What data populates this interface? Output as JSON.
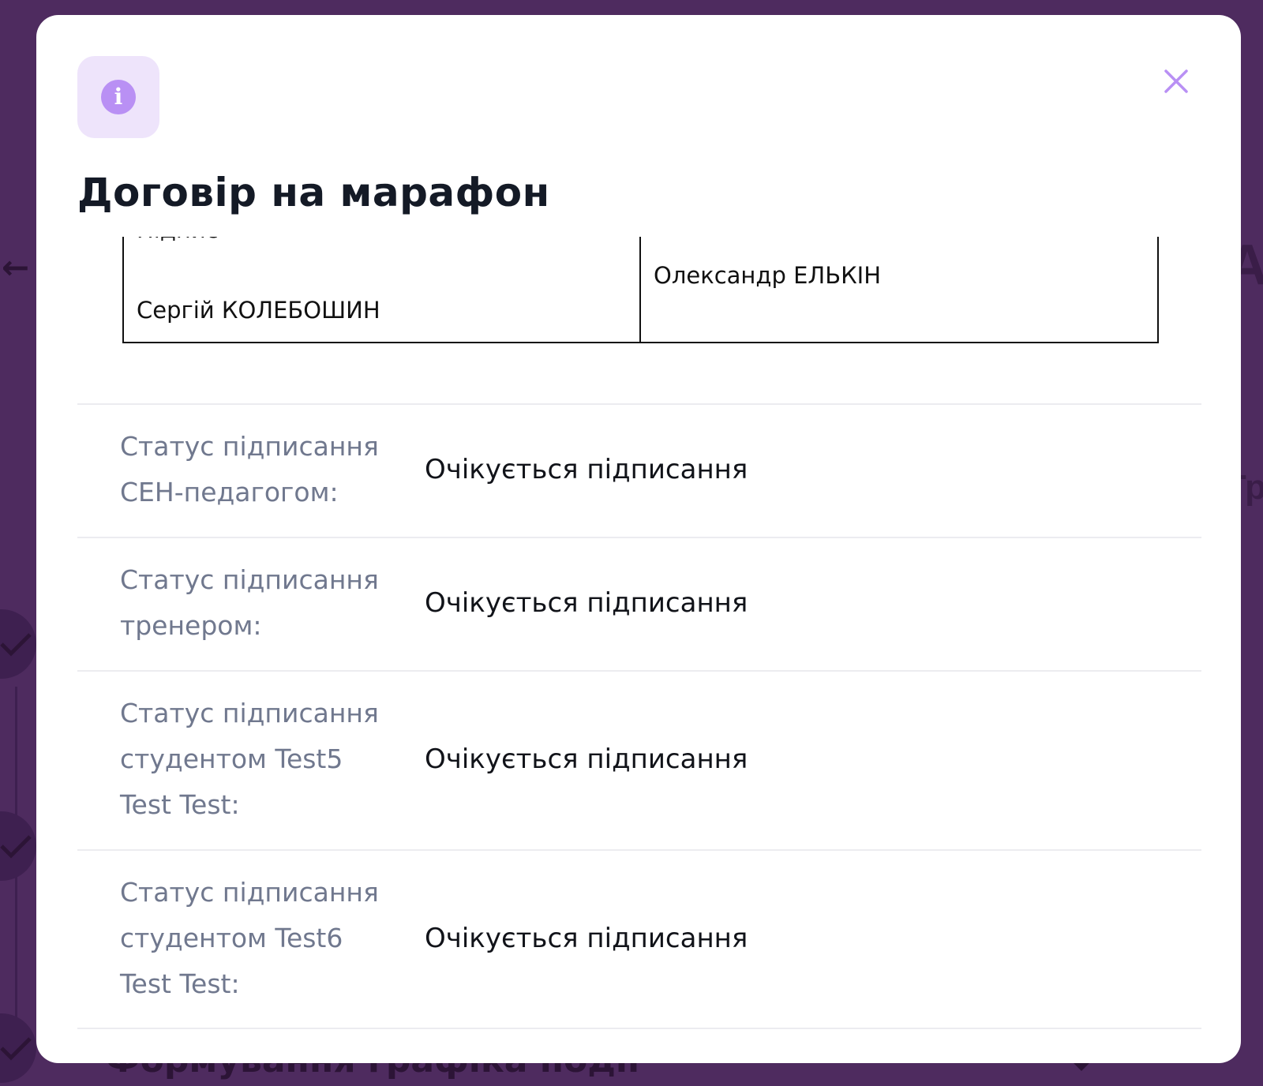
{
  "background": {
    "back_arrow": "←",
    "edge_letter_top": "А",
    "edge_letter_mid": "Тр",
    "section_title": "Формування графіка події"
  },
  "modal": {
    "title": "Договір на марафон",
    "close_symbol": "✕",
    "info_symbol": "i",
    "signature_table": {
      "left_partial_text": "Підпис",
      "left_name": "Сергій КОЛЕБОШИН",
      "right_name": "Олександр ЕЛЬКІН"
    },
    "statuses": [
      {
        "label": "Статус підписання СЕН-педагогом:",
        "value": "Очікується підписання"
      },
      {
        "label": "Статус підписання тренером:",
        "value": "Очікується підписання"
      },
      {
        "label": "Статус підписання студентом Test5 Test Test:",
        "value": "Очікується підписання"
      },
      {
        "label": "Статус підписання студентом Test6 Test Test:",
        "value": "Очікується підписання"
      }
    ]
  },
  "colors": {
    "overlay_background": "#4e2b5f",
    "modal_background": "#ffffff",
    "accent": "#b990f4",
    "accent_soft": "#eee4fb",
    "label_text": "#70788e",
    "title_text": "#141a26"
  }
}
